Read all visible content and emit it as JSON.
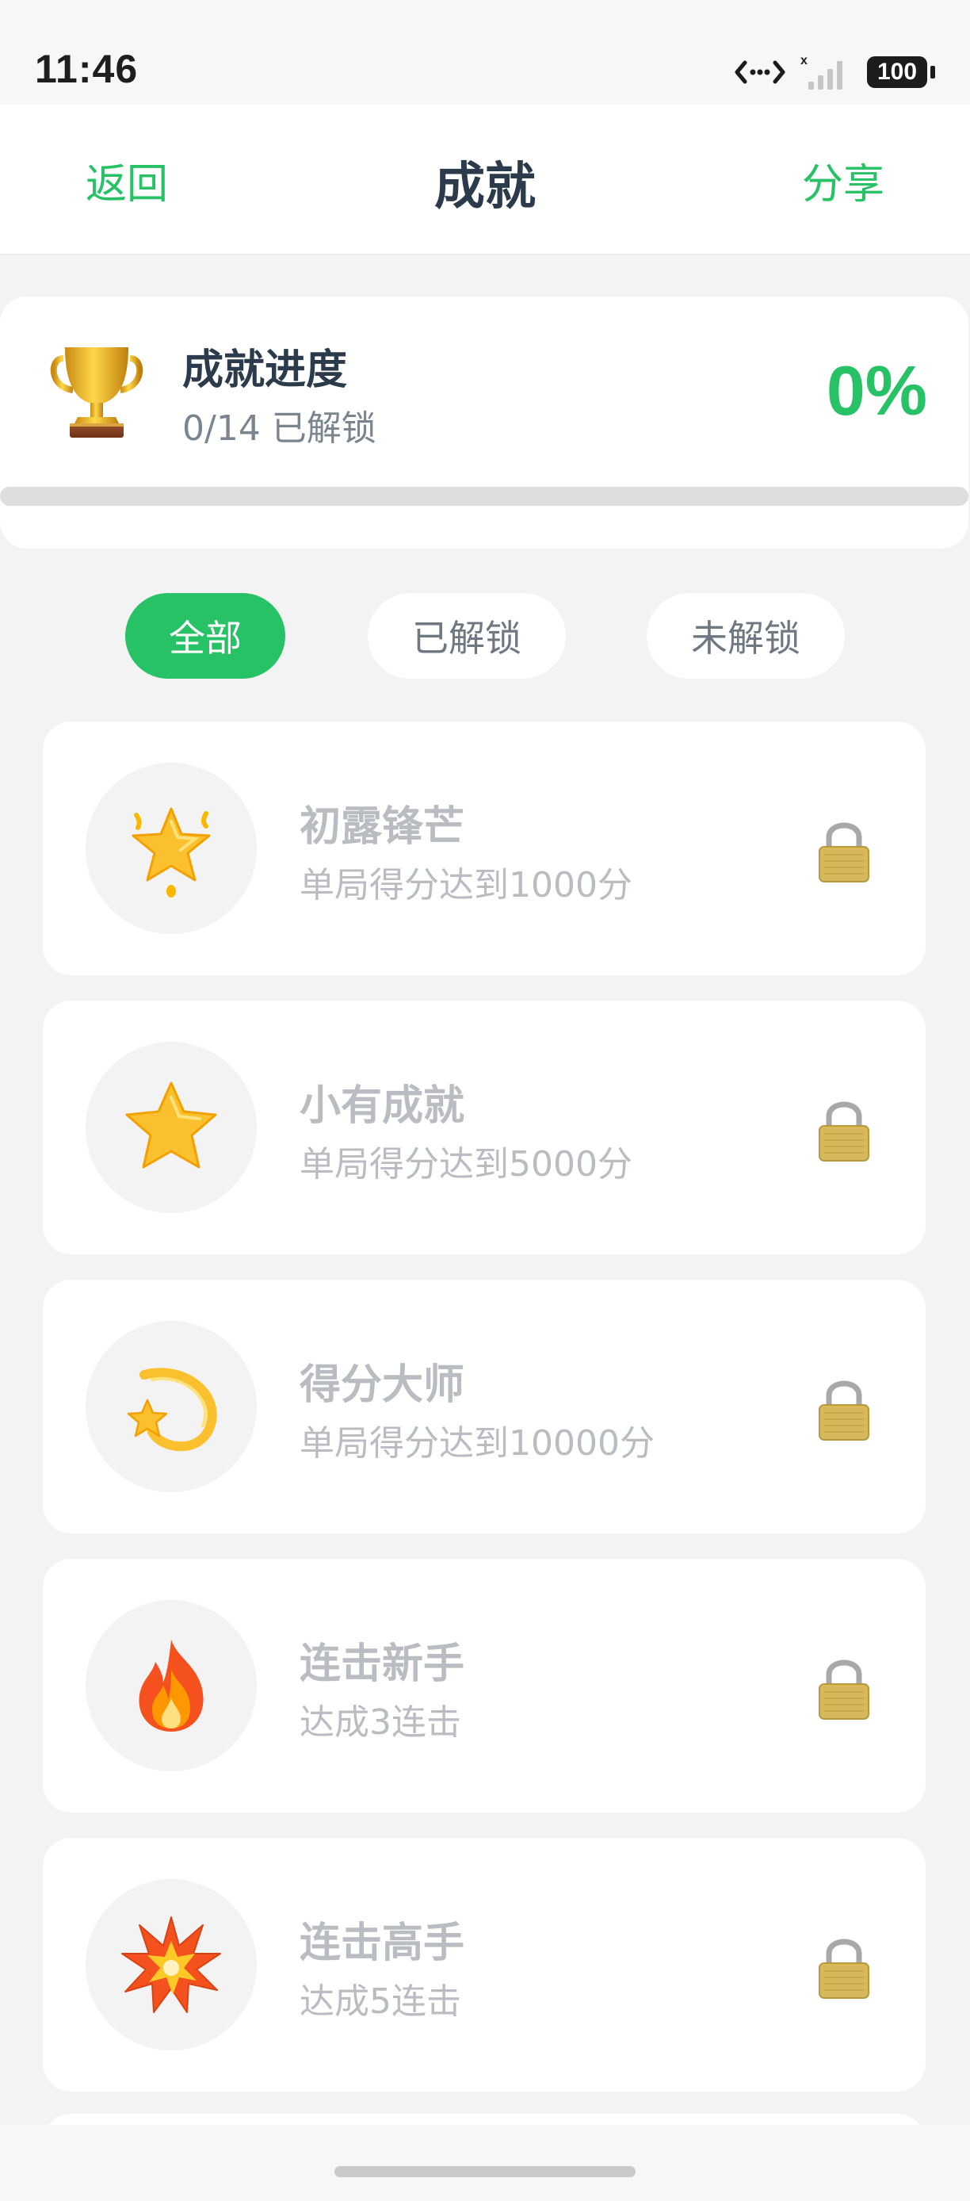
{
  "status_bar": {
    "time": "11:46",
    "battery": "100"
  },
  "nav": {
    "back_label": "返回",
    "title": "成就",
    "share_label": "分享"
  },
  "progress": {
    "title": "成就进度",
    "unlocked_text": "0/14 已解锁",
    "percent_text": "0%",
    "percent_value": 0
  },
  "tabs": [
    {
      "label": "全部",
      "active": true
    },
    {
      "label": "已解锁",
      "active": false
    },
    {
      "label": "未解锁",
      "active": false
    }
  ],
  "achievements": [
    {
      "icon": "sparkle-star-icon",
      "title": "初露锋芒",
      "desc": "单局得分达到1000分",
      "locked": true
    },
    {
      "icon": "star-icon",
      "title": "小有成就",
      "desc": "单局得分达到5000分",
      "locked": true
    },
    {
      "icon": "shooting-star-icon",
      "title": "得分大师",
      "desc": "单局得分达到10000分",
      "locked": true
    },
    {
      "icon": "fire-icon",
      "title": "连击新手",
      "desc": "达成3连击",
      "locked": true
    },
    {
      "icon": "explosion-icon",
      "title": "连击高手",
      "desc": "达成5连击",
      "locked": true
    }
  ],
  "colors": {
    "accent": "#27c266",
    "title_dark": "#2c3b4b",
    "locked_text": "#b9bdc1",
    "background": "#f3f3f3"
  }
}
